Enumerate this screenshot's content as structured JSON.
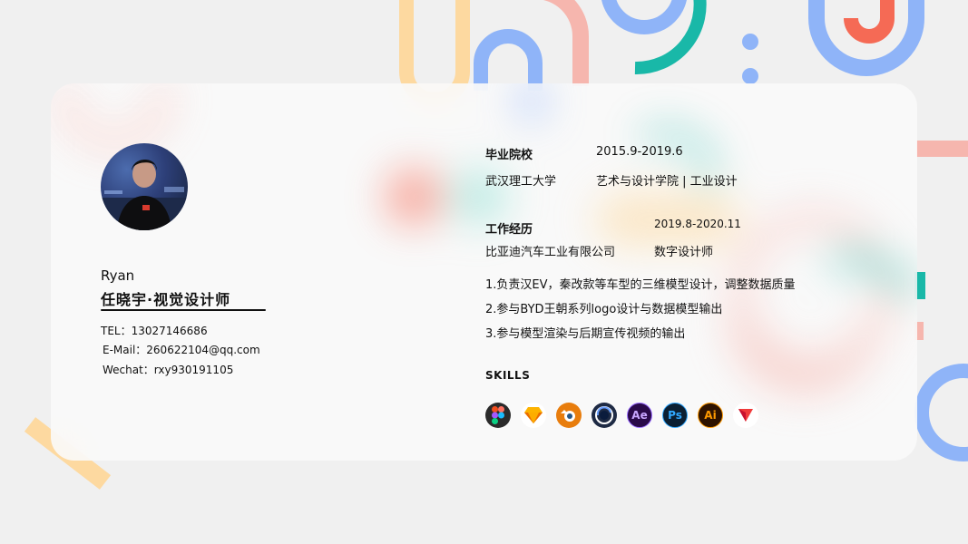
{
  "profile": {
    "name_en": "Ryan",
    "name_cn": "任晓宇·视觉设计师",
    "tel": "TEL：13027146686",
    "email": "E-Mail：260622104@qq.com",
    "wechat": "Wechat：rxy930191105"
  },
  "education": {
    "label": "毕业院校",
    "period": "2015.9-2019.6",
    "school": "武汉理工大学",
    "major": "艺术与设计学院 | 工业设计"
  },
  "work": {
    "label": "工作经历",
    "period": "2019.8-2020.11",
    "company": "比亚迪汽车工业有限公司",
    "role": "数字设计师",
    "items": [
      "1.负责汉EV，秦改款等车型的三维模型设计，调整数据质量",
      "2.参与BYD王朝系列logo设计与数据模型输出",
      "3.参与模型渲染与后期宣传视频的输出"
    ]
  },
  "skills": {
    "title": "SKILLS",
    "icons": [
      {
        "name": "figma-icon",
        "glyph": "",
        "bg": "#2b2b2b"
      },
      {
        "name": "sketch-icon",
        "glyph": "",
        "bg": "#ffffff"
      },
      {
        "name": "blender-icon",
        "glyph": "",
        "bg": "#e87d0d"
      },
      {
        "name": "cinema4d-icon",
        "glyph": "",
        "bg": "#1e2a44"
      },
      {
        "name": "after-effects-icon",
        "glyph": "Ae",
        "bg": "#2a0a4a"
      },
      {
        "name": "photoshop-icon",
        "glyph": "Ps",
        "bg": "#0b1f33"
      },
      {
        "name": "illustrator-icon",
        "glyph": "Ai",
        "bg": "#2e1300"
      },
      {
        "name": "vectary-icon",
        "glyph": "",
        "bg": "#ffffff"
      }
    ]
  },
  "colors": {
    "blue": "#8fb4f8",
    "coral": "#f56a55",
    "pink": "#f6b6ae",
    "teal": "#19b8a8",
    "yellow": "#fdd9a0"
  }
}
